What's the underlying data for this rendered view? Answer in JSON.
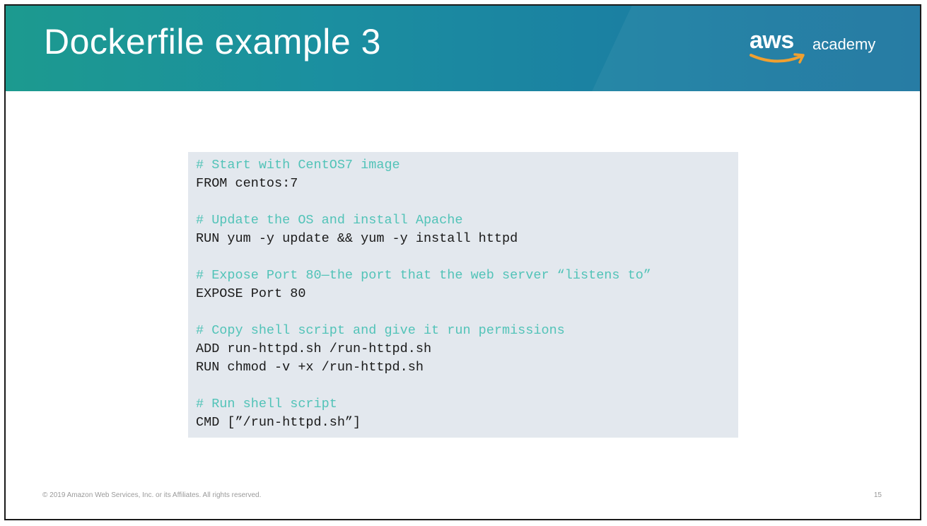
{
  "slide": {
    "title": "Dockerfile example 3",
    "logo": {
      "brand": "aws",
      "product": "academy",
      "icon": "aws-smile-arrow-icon",
      "arrow_color": "#f0a030"
    },
    "code_lines": [
      {
        "kind": "comment",
        "text": "# Start with CentOS7 image"
      },
      {
        "kind": "command",
        "text": "FROM centos:7"
      },
      {
        "kind": "blank",
        "text": ""
      },
      {
        "kind": "comment",
        "text": "# Update the OS and install Apache"
      },
      {
        "kind": "command",
        "text": "RUN yum -y update && yum -y install httpd"
      },
      {
        "kind": "blank",
        "text": ""
      },
      {
        "kind": "comment",
        "text": "# Expose Port 80—the port that the web server “listens to”"
      },
      {
        "kind": "command",
        "text": "EXPOSE Port 80"
      },
      {
        "kind": "blank",
        "text": ""
      },
      {
        "kind": "comment",
        "text": "# Copy shell script and give it run permissions"
      },
      {
        "kind": "command",
        "text": "ADD run-httpd.sh /run-httpd.sh"
      },
      {
        "kind": "command",
        "text": "RUN chmod -v +x /run-httpd.sh"
      },
      {
        "kind": "blank",
        "text": ""
      },
      {
        "kind": "comment",
        "text": "# Run shell script"
      },
      {
        "kind": "command",
        "text": "CMD [”/run-httpd.sh”]"
      }
    ],
    "footer": {
      "copyright": "© 2019 Amazon Web Services, Inc. or its Affiliates. All rights reserved.",
      "page_number": "15"
    },
    "colors": {
      "header_teal": "#1c9a8f",
      "header_blue": "#1c75a0",
      "code_background": "#e3e8ee",
      "comment_text": "#52c3b8",
      "command_text": "#1a1a1a"
    }
  }
}
